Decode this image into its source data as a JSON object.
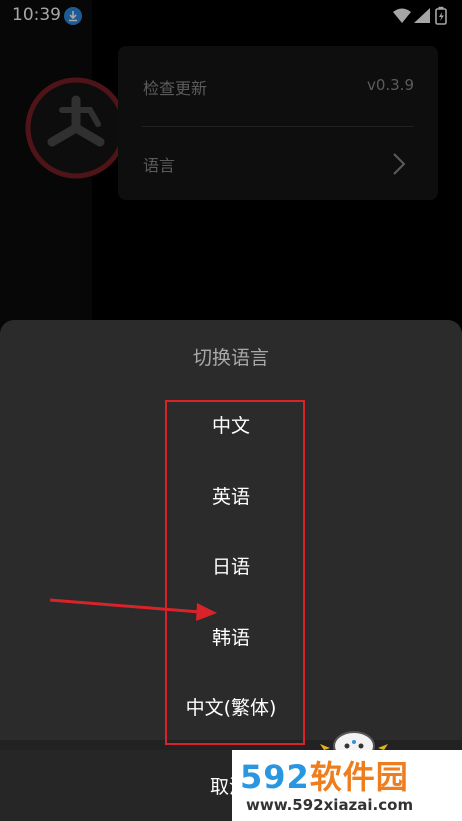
{
  "status_bar": {
    "time": "10:39",
    "icons": [
      "download-icon",
      "wifi-icon",
      "signal-icon",
      "battery-icon"
    ]
  },
  "settings": {
    "check_update": {
      "label": "检查更新",
      "value": "v0.3.9"
    },
    "language": {
      "label": "语言"
    }
  },
  "language_sheet": {
    "title": "切换语言",
    "options": [
      "中文",
      "英语",
      "日语",
      "韩语",
      "中文(繁体)"
    ],
    "cancel_label": "取消"
  },
  "watermark": {
    "text_prefix": "592",
    "text_suffix": "软件园",
    "url": "www.592xiazai.com"
  },
  "colors": {
    "sheet_bg": "#2b2b2b",
    "highlight": "#d9232a",
    "watermark_blue": "#2b96e0",
    "watermark_orange": "#ef7d1e"
  }
}
